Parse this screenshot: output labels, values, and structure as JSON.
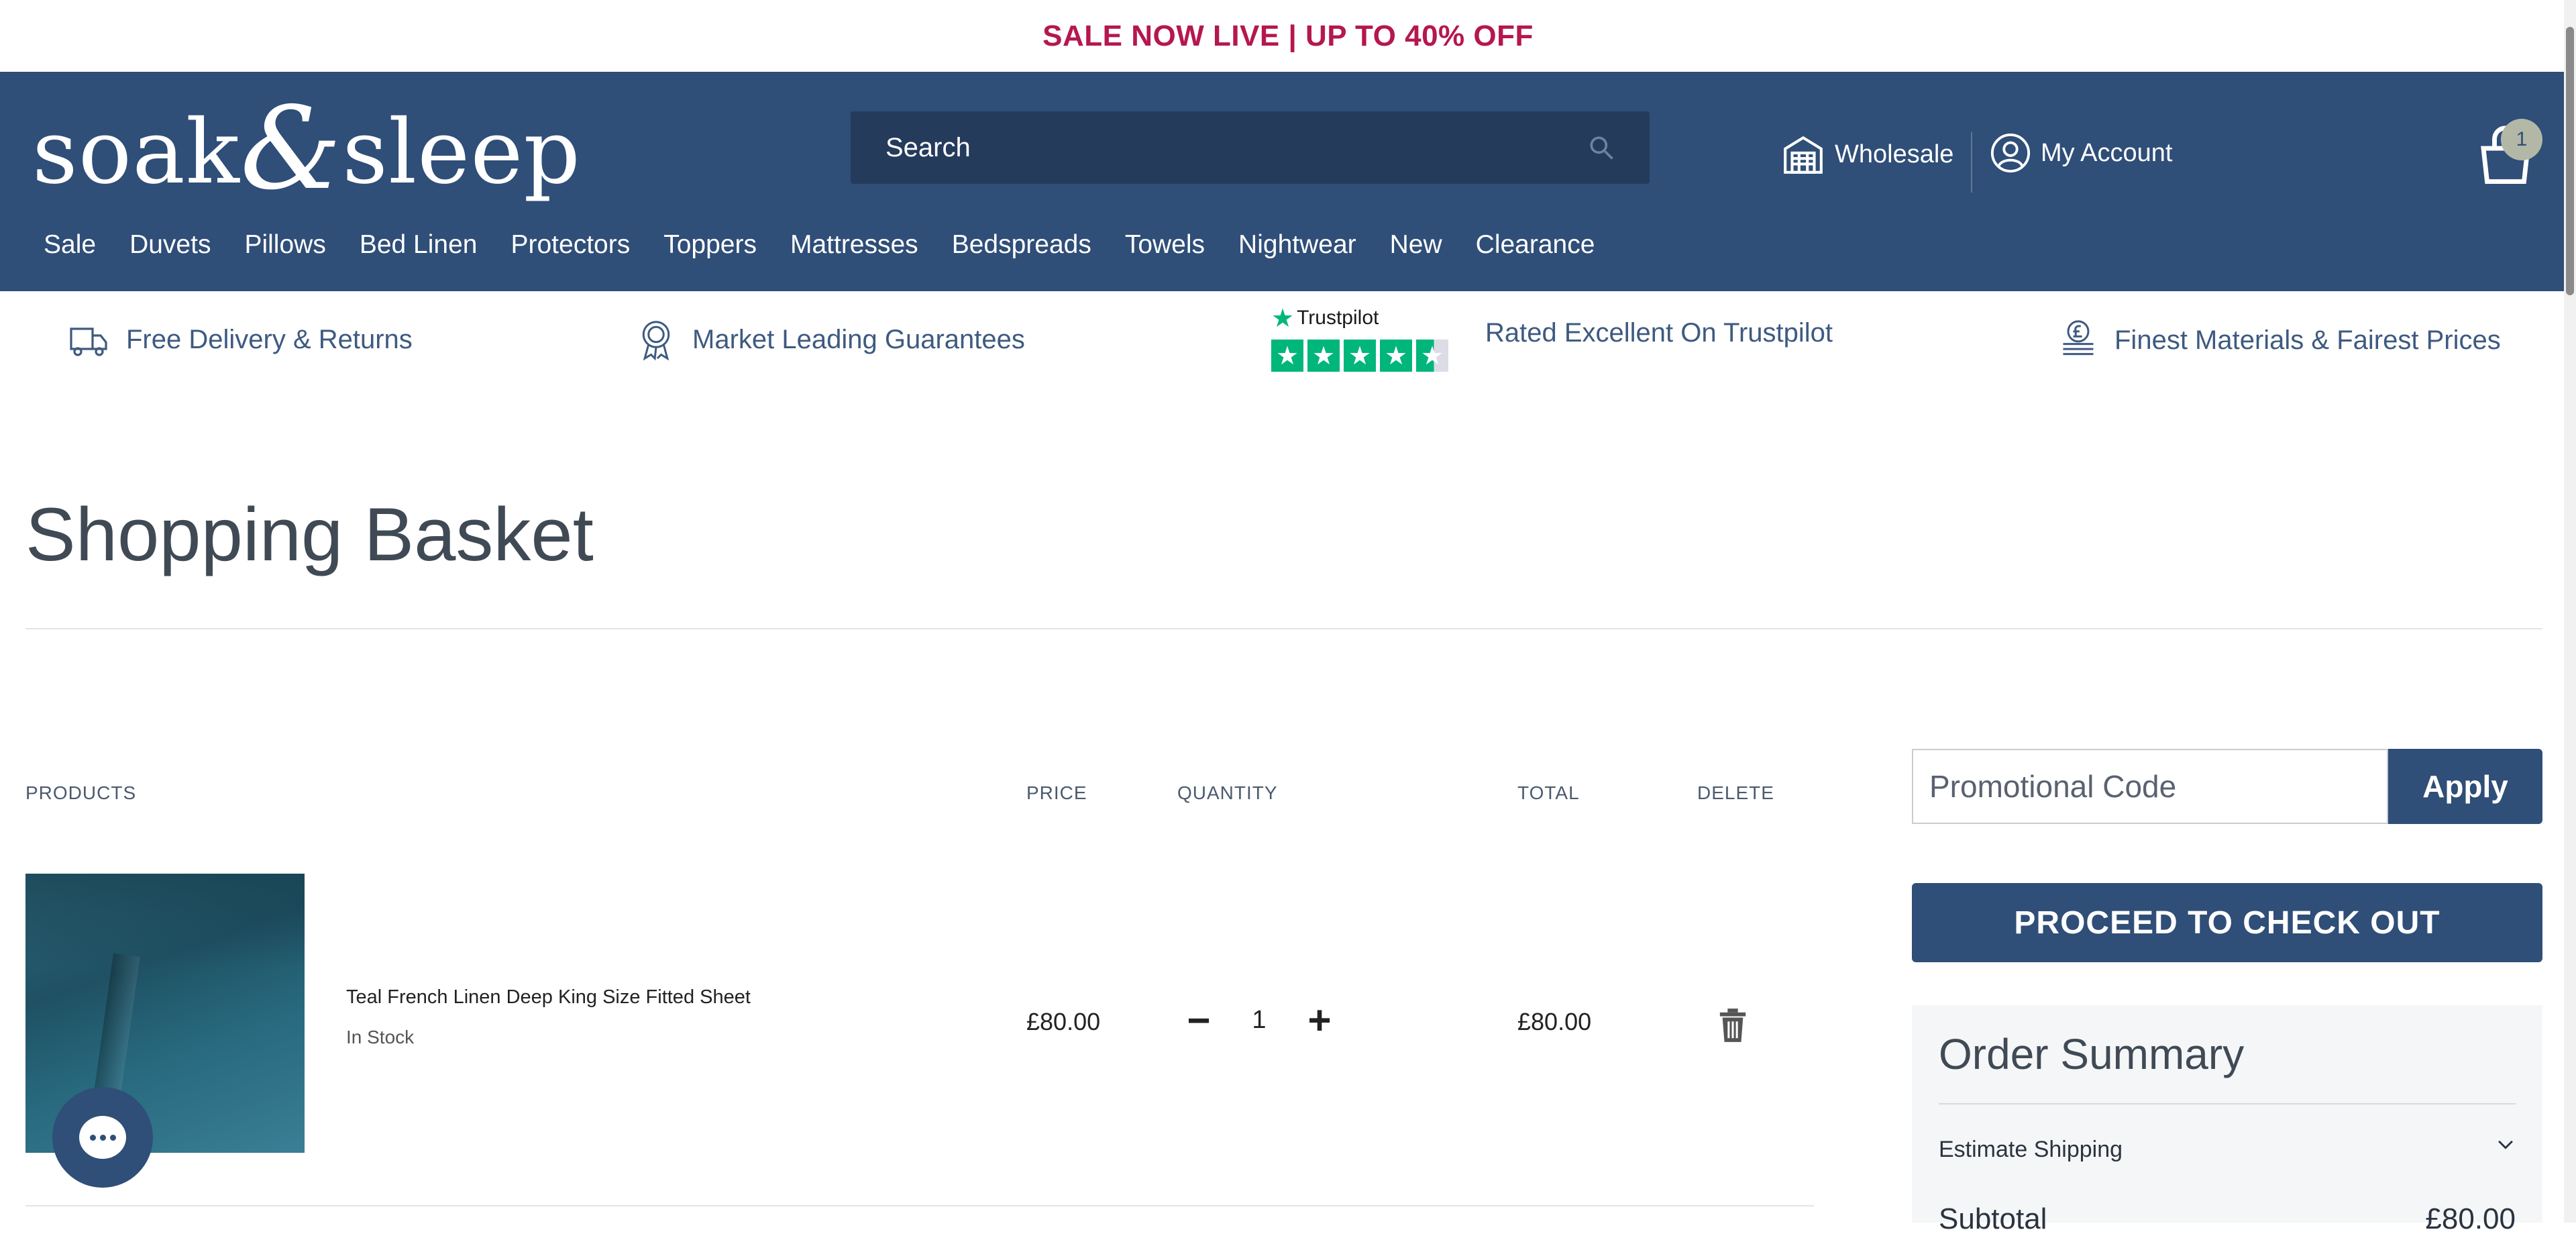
{
  "promo_bar": {
    "text": "SALE NOW LIVE | UP TO 40% OFF"
  },
  "header": {
    "logo": {
      "part1": "soak",
      "amp": "&",
      "part2": "sleep"
    },
    "search": {
      "placeholder": "Search"
    },
    "wholesale_label": "Wholesale",
    "account_label": "My Account",
    "cart_count": "1",
    "nav": [
      "Sale",
      "Duvets",
      "Pillows",
      "Bed Linen",
      "Protectors",
      "Toppers",
      "Mattresses",
      "Bedspreads",
      "Towels",
      "Nightwear",
      "New",
      "Clearance"
    ]
  },
  "usp": {
    "delivery": "Free Delivery & Returns",
    "guarantees": "Market Leading Guarantees",
    "trustpilot_brand": "Trustpilot",
    "trustpilot_text": "Rated Excellent On Trustpilot",
    "trustpilot_rating": 4.5,
    "materials": "Finest Materials & Fairest Prices"
  },
  "page_title": "Shopping Basket",
  "table": {
    "headers": {
      "products": "PRODUCTS",
      "price": "PRICE",
      "quantity": "QUANTITY",
      "total": "TOTAL",
      "delete": "DELETE"
    },
    "rows": [
      {
        "name": "Teal French Linen Deep King Size Fitted Sheet",
        "stock": "In Stock",
        "price": "£80.00",
        "quantity": "1",
        "total": "£80.00"
      }
    ]
  },
  "sidebar": {
    "promo_placeholder": "Promotional Code",
    "apply_label": "Apply",
    "checkout_label": "PROCEED TO CHECK OUT",
    "summary_title": "Order Summary",
    "estimate_shipping": "Estimate Shipping",
    "subtotal_label": "Subtotal",
    "subtotal_value": "£80.00"
  },
  "colors": {
    "brand": "#2f4e78",
    "sale": "#b5174f",
    "trustpilot": "#00b67a"
  }
}
